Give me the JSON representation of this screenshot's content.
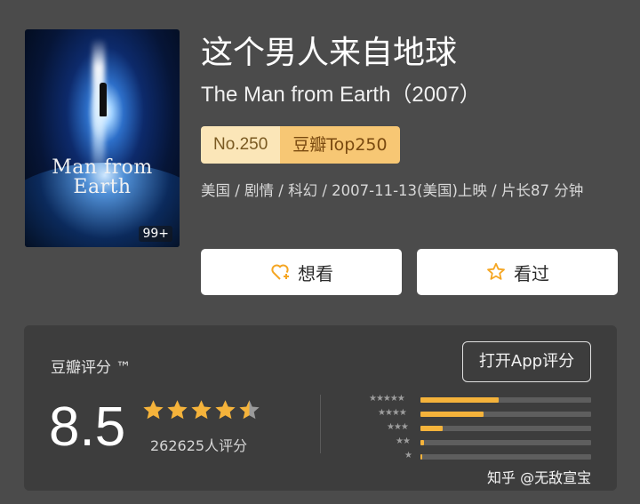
{
  "movie": {
    "title_cn": "这个男人来自地球",
    "title_en": "The Man from Earth（2007）",
    "rank_no": "No.250",
    "rank_list": "豆瓣Top250",
    "meta": "美国 / 剧情 / 科幻 / 2007-11-13(美国)上映 / 片长87 分钟",
    "poster_title": "Man from Earth",
    "poster_count": "99+"
  },
  "actions": {
    "want_label": "想看",
    "seen_label": "看过",
    "want_icon": "heart-plus-icon",
    "seen_icon": "star-outline-icon"
  },
  "rating": {
    "label": "豆瓣评分 ™",
    "open_app": "打开App评分",
    "score": "8.5",
    "stars": 4.5,
    "votes": "262625人评分",
    "star_color": "#f5b33b",
    "distribution": [
      {
        "stars": 5,
        "fraction": 0.46
      },
      {
        "stars": 4,
        "fraction": 0.37
      },
      {
        "stars": 3,
        "fraction": 0.13
      },
      {
        "stars": 2,
        "fraction": 0.02
      },
      {
        "stars": 1,
        "fraction": 0.01
      }
    ]
  },
  "watermark": {
    "text": "知乎 @无敌宣宝"
  }
}
